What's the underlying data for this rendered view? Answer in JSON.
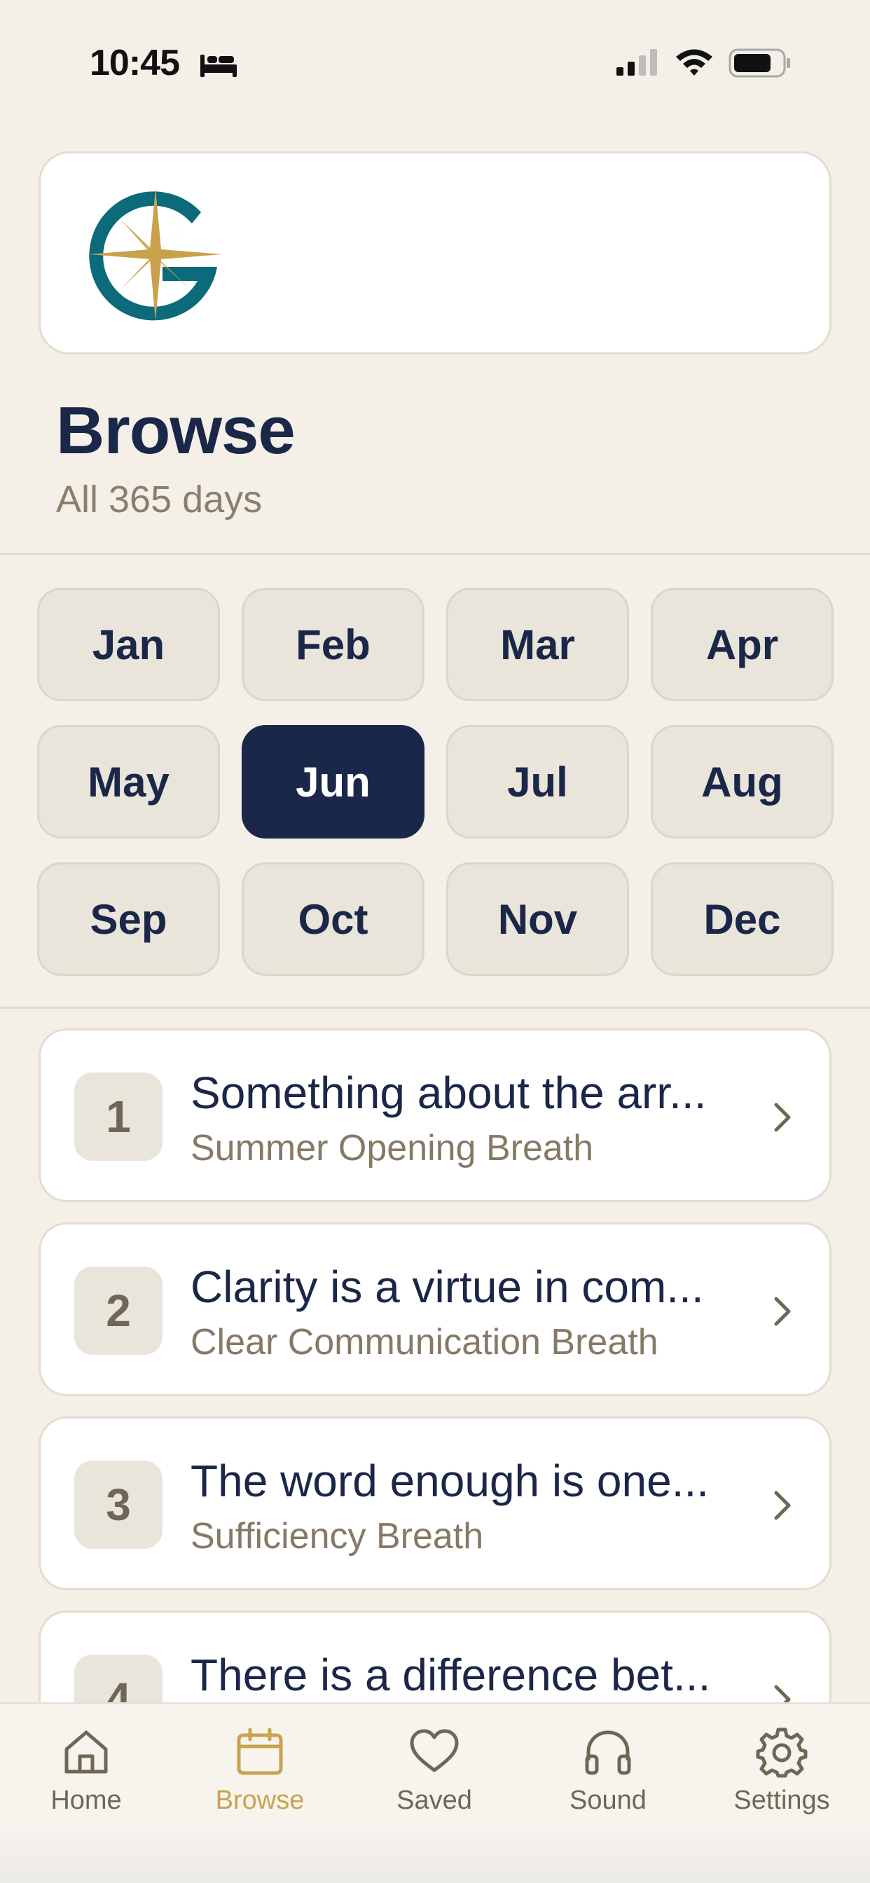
{
  "status_bar": {
    "time": "10:45",
    "icons": [
      "bed-icon",
      "cellular-signal-icon",
      "wifi-icon",
      "battery-icon"
    ]
  },
  "brand": {
    "logo_icon": "compass-star-g-logo",
    "colors": {
      "teal": "#0B6B7A",
      "gold": "#C9A14A"
    }
  },
  "header": {
    "title": "Browse",
    "subtitle": "All 365 days"
  },
  "months": {
    "items": [
      "Jan",
      "Feb",
      "Mar",
      "Apr",
      "May",
      "Jun",
      "Jul",
      "Aug",
      "Sep",
      "Oct",
      "Nov",
      "Dec"
    ],
    "selected": "Jun"
  },
  "entries": [
    {
      "day": "1",
      "title": "Something about the arr...",
      "subtitle": "Summer Opening Breath"
    },
    {
      "day": "2",
      "title": "Clarity is a virtue in com...",
      "subtitle": "Clear Communication Breath"
    },
    {
      "day": "3",
      "title": "The word enough is one...",
      "subtitle": "Sufficiency Breath"
    },
    {
      "day": "4",
      "title": "There is a difference bet...",
      "subtitle": ""
    }
  ],
  "tabs": [
    {
      "label": "Home",
      "icon": "home-icon"
    },
    {
      "label": "Browse",
      "icon": "calendar-icon"
    },
    {
      "label": "Saved",
      "icon": "heart-icon"
    },
    {
      "label": "Sound",
      "icon": "headphones-icon"
    },
    {
      "label": "Settings",
      "icon": "gear-icon"
    }
  ],
  "active_tab": "Browse",
  "colors": {
    "background": "#F4F0E8",
    "navy": "#1B2748",
    "gold_accent": "#C8A350",
    "muted_text": "#857A66"
  }
}
